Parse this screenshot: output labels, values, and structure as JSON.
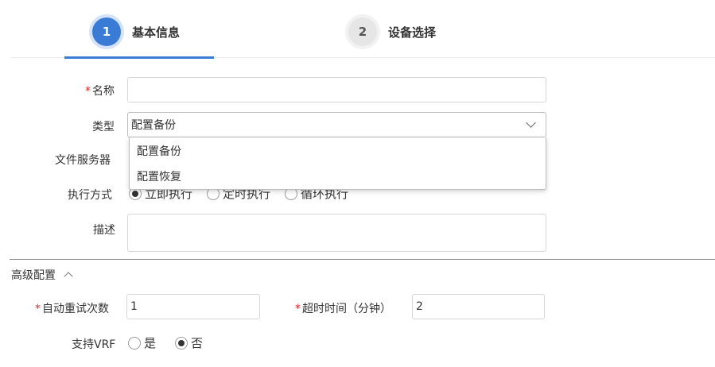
{
  "steps": [
    {
      "number": "1",
      "label": "基本信息",
      "active": true
    },
    {
      "number": "2",
      "label": "设备选择",
      "active": false
    }
  ],
  "form": {
    "name_label": "名称",
    "name_value": "",
    "type_label": "类型",
    "type_value": "配置备份",
    "type_options": [
      "配置备份",
      "配置恢复"
    ],
    "file_server_label": "文件服务器",
    "exec_mode_label": "执行方式",
    "exec_options": [
      "立即执行",
      "定时执行",
      "循环执行"
    ],
    "exec_selected": "立即执行",
    "description_label": "描述",
    "description_value": ""
  },
  "advanced": {
    "title": "高级配置",
    "retry_label": "自动重试次数",
    "retry_value": "1",
    "timeout_label": "超时时间（分钟）",
    "timeout_value": "2",
    "vrf_label": "支持VRF",
    "vrf_options": [
      "是",
      "否"
    ],
    "vrf_selected": "否"
  },
  "colors": {
    "accent": "#3a7bd5",
    "required": "#e0262d"
  }
}
